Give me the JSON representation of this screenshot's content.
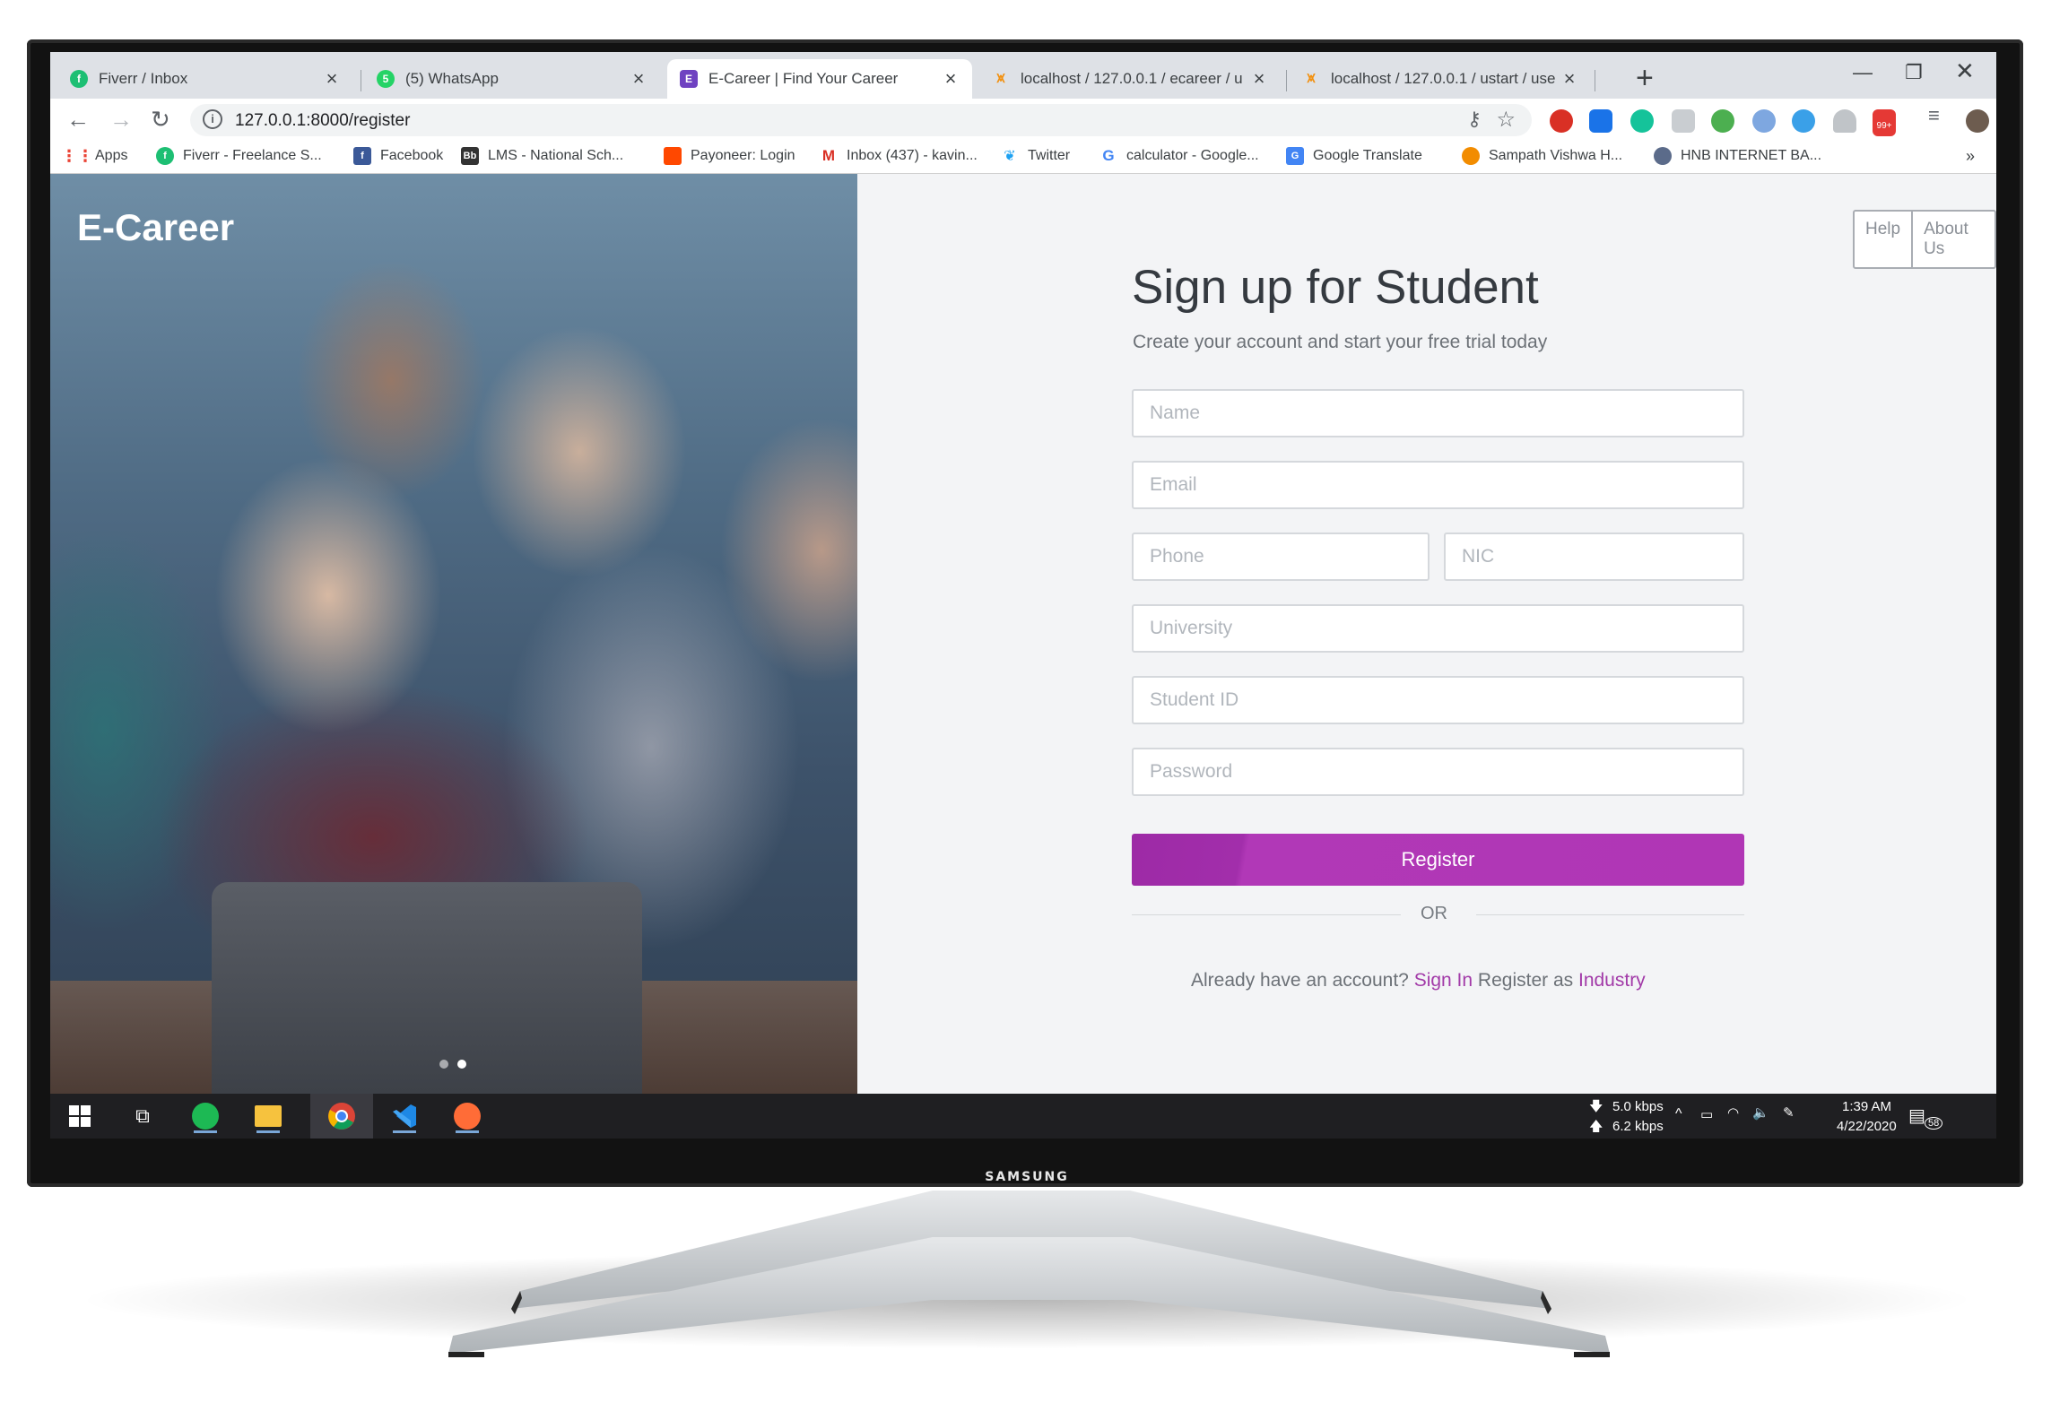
{
  "browser": {
    "tabs": [
      {
        "title": "Fiverr / Inbox",
        "icon": "fiverr-icon",
        "color": "#1dbf73"
      },
      {
        "title": "(5) WhatsApp",
        "icon": "whatsapp-icon",
        "color": "#25d366"
      },
      {
        "title": "E-Career | Find Your Career",
        "icon": "ecareer-icon",
        "color": "#6f42c1",
        "active": true
      },
      {
        "title": "localhost / 127.0.0.1 / ecareer / u",
        "icon": "phpmyadmin-icon",
        "color": "#f29111"
      },
      {
        "title": "localhost / 127.0.0.1 / ustart / use",
        "icon": "phpmyadmin-icon",
        "color": "#f29111"
      }
    ],
    "url": "127.0.0.1:8000/register",
    "bookmarks": [
      {
        "label": "Apps",
        "icon": "apps-grid-icon"
      },
      {
        "label": "Fiverr - Freelance S...",
        "icon": "fiverr-icon"
      },
      {
        "label": "Facebook",
        "icon": "facebook-icon"
      },
      {
        "label": "LMS - National Sch...",
        "icon": "blackboard-icon"
      },
      {
        "label": "Payoneer: Login",
        "icon": "payoneer-icon"
      },
      {
        "label": "Inbox (437) - kavin...",
        "icon": "gmail-icon"
      },
      {
        "label": "Twitter",
        "icon": "twitter-icon"
      },
      {
        "label": "calculator - Google...",
        "icon": "google-icon"
      },
      {
        "label": "Google Translate",
        "icon": "translate-icon"
      },
      {
        "label": "Sampath Vishwa H...",
        "icon": "sampath-icon"
      },
      {
        "label": "HNB INTERNET BA...",
        "icon": "hnb-icon"
      }
    ],
    "more_bookmarks": "»",
    "badge_99": "99+"
  },
  "page": {
    "logo": "E-Career",
    "help": "Help",
    "about": "About Us",
    "title": "Sign up for Student",
    "subtitle": "Create your account and start your free trial today",
    "fields": {
      "name": "Name",
      "email": "Email",
      "phone": "Phone",
      "nic": "NIC",
      "university": "University",
      "student_id": "Student ID",
      "password": "Password"
    },
    "register": "Register",
    "or": "OR",
    "have_account": "Already have an account?",
    "sign_in": "Sign In",
    "register_as": "Register as",
    "industry": "Industry",
    "accent_color": "#a93ab0"
  },
  "taskbar": {
    "download_speed": "5.0 kbps",
    "upload_speed": "6.2 kbps",
    "time": "1:39 AM",
    "date": "4/22/2020",
    "notifications": "58"
  },
  "monitor": {
    "brand": "SAMSUNG"
  }
}
